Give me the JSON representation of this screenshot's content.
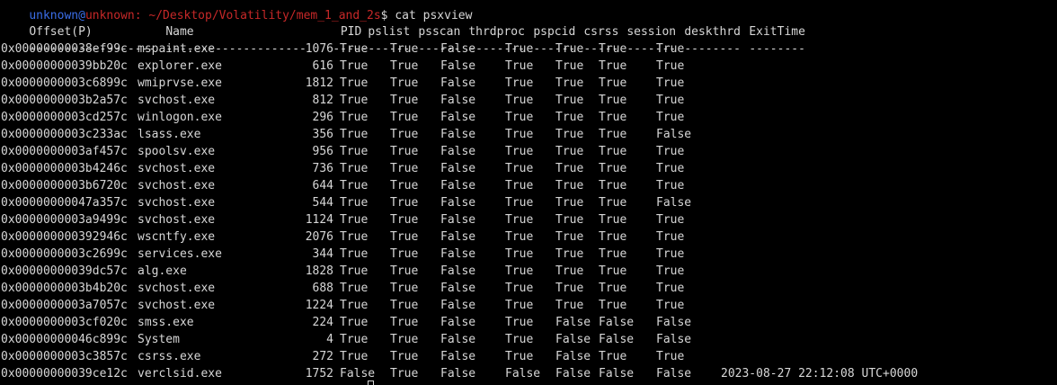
{
  "prompt": {
    "user": "unknown",
    "at": "@",
    "host": "unknown",
    "path": ": ~/Desktop/Volatility/mem_1_and_2s",
    "symbol": "$",
    "command": " cat psxview"
  },
  "table": {
    "headers": {
      "offset": "Offset(P)",
      "name": "Name",
      "pid": "PID",
      "pslist": "pslist",
      "psscan": "psscan",
      "thrdproc": "thrdproc",
      "pspcid": "pspcid",
      "csrss": "csrss",
      "session": "session",
      "deskthrd": "deskthrd",
      "exittime": "ExitTime"
    },
    "separators": {
      "offset": "------------------",
      "name": "--------------------",
      "pid": "------",
      "pslist": "------",
      "psscan": "------",
      "thrdproc": "--------",
      "pspcid": "------",
      "csrss": "-----",
      "session": "-------",
      "deskthrd": "--------",
      "exittime": "--------"
    },
    "rows": [
      {
        "offset": "0x00000000038ef99c",
        "name": "mspaint.exe",
        "pid": "1076",
        "pslist": "True",
        "psscan": "True",
        "thrdproc": "False",
        "pspcid": "True",
        "csrss": "True",
        "session": "True",
        "deskthrd": "True",
        "exittime": ""
      },
      {
        "offset": "0x00000000039bb20c",
        "name": "explorer.exe",
        "pid": "616",
        "pslist": "True",
        "psscan": "True",
        "thrdproc": "False",
        "pspcid": "True",
        "csrss": "True",
        "session": "True",
        "deskthrd": "True",
        "exittime": ""
      },
      {
        "offset": "0x0000000003c6899c",
        "name": "wmiprvse.exe",
        "pid": "1812",
        "pslist": "True",
        "psscan": "True",
        "thrdproc": "False",
        "pspcid": "True",
        "csrss": "True",
        "session": "True",
        "deskthrd": "True",
        "exittime": ""
      },
      {
        "offset": "0x0000000003b2a57c",
        "name": "svchost.exe",
        "pid": "812",
        "pslist": "True",
        "psscan": "True",
        "thrdproc": "False",
        "pspcid": "True",
        "csrss": "True",
        "session": "True",
        "deskthrd": "True",
        "exittime": ""
      },
      {
        "offset": "0x0000000003cd257c",
        "name": "winlogon.exe",
        "pid": "296",
        "pslist": "True",
        "psscan": "True",
        "thrdproc": "False",
        "pspcid": "True",
        "csrss": "True",
        "session": "True",
        "deskthrd": "True",
        "exittime": ""
      },
      {
        "offset": "0x0000000003c233ac",
        "name": "lsass.exe",
        "pid": "356",
        "pslist": "True",
        "psscan": "True",
        "thrdproc": "False",
        "pspcid": "True",
        "csrss": "True",
        "session": "True",
        "deskthrd": "False",
        "exittime": ""
      },
      {
        "offset": "0x0000000003af457c",
        "name": "spoolsv.exe",
        "pid": "956",
        "pslist": "True",
        "psscan": "True",
        "thrdproc": "False",
        "pspcid": "True",
        "csrss": "True",
        "session": "True",
        "deskthrd": "True",
        "exittime": ""
      },
      {
        "offset": "0x0000000003b4246c",
        "name": "svchost.exe",
        "pid": "736",
        "pslist": "True",
        "psscan": "True",
        "thrdproc": "False",
        "pspcid": "True",
        "csrss": "True",
        "session": "True",
        "deskthrd": "True",
        "exittime": ""
      },
      {
        "offset": "0x0000000003b6720c",
        "name": "svchost.exe",
        "pid": "644",
        "pslist": "True",
        "psscan": "True",
        "thrdproc": "False",
        "pspcid": "True",
        "csrss": "True",
        "session": "True",
        "deskthrd": "True",
        "exittime": ""
      },
      {
        "offset": "0x00000000047a357c",
        "name": "svchost.exe",
        "pid": "544",
        "pslist": "True",
        "psscan": "True",
        "thrdproc": "False",
        "pspcid": "True",
        "csrss": "True",
        "session": "True",
        "deskthrd": "False",
        "exittime": ""
      },
      {
        "offset": "0x0000000003a9499c",
        "name": "svchost.exe",
        "pid": "1124",
        "pslist": "True",
        "psscan": "True",
        "thrdproc": "False",
        "pspcid": "True",
        "csrss": "True",
        "session": "True",
        "deskthrd": "True",
        "exittime": ""
      },
      {
        "offset": "0x000000000392946c",
        "name": "wscntfy.exe",
        "pid": "2076",
        "pslist": "True",
        "psscan": "True",
        "thrdproc": "False",
        "pspcid": "True",
        "csrss": "True",
        "session": "True",
        "deskthrd": "True",
        "exittime": ""
      },
      {
        "offset": "0x0000000003c2699c",
        "name": "services.exe",
        "pid": "344",
        "pslist": "True",
        "psscan": "True",
        "thrdproc": "False",
        "pspcid": "True",
        "csrss": "True",
        "session": "True",
        "deskthrd": "True",
        "exittime": ""
      },
      {
        "offset": "0x00000000039dc57c",
        "name": "alg.exe",
        "pid": "1828",
        "pslist": "True",
        "psscan": "True",
        "thrdproc": "False",
        "pspcid": "True",
        "csrss": "True",
        "session": "True",
        "deskthrd": "True",
        "exittime": ""
      },
      {
        "offset": "0x0000000003b4b20c",
        "name": "svchost.exe",
        "pid": "688",
        "pslist": "True",
        "psscan": "True",
        "thrdproc": "False",
        "pspcid": "True",
        "csrss": "True",
        "session": "True",
        "deskthrd": "True",
        "exittime": ""
      },
      {
        "offset": "0x0000000003a7057c",
        "name": "svchost.exe",
        "pid": "1224",
        "pslist": "True",
        "psscan": "True",
        "thrdproc": "False",
        "pspcid": "True",
        "csrss": "True",
        "session": "True",
        "deskthrd": "True",
        "exittime": ""
      },
      {
        "offset": "0x0000000003cf020c",
        "name": "smss.exe",
        "pid": "224",
        "pslist": "True",
        "psscan": "True",
        "thrdproc": "False",
        "pspcid": "True",
        "csrss": "False",
        "session": "False",
        "deskthrd": "False",
        "exittime": ""
      },
      {
        "offset": "0x00000000046c899c",
        "name": "System",
        "pid": "4",
        "pslist": "True",
        "psscan": "True",
        "thrdproc": "False",
        "pspcid": "True",
        "csrss": "False",
        "session": "False",
        "deskthrd": "False",
        "exittime": ""
      },
      {
        "offset": "0x0000000003c3857c",
        "name": "csrss.exe",
        "pid": "272",
        "pslist": "True",
        "psscan": "True",
        "thrdproc": "False",
        "pspcid": "True",
        "csrss": "False",
        "session": "True",
        "deskthrd": "True",
        "exittime": ""
      },
      {
        "offset": "0x00000000039ce12c",
        "name": "verclsid.exe",
        "pid": "1752",
        "pslist": "False",
        "psscan": "True",
        "thrdproc": "False",
        "pspcid": "False",
        "csrss": "False",
        "session": "False",
        "deskthrd": "False",
        "exittime": "2023-08-27 22:12:08 UTC+0000"
      }
    ]
  }
}
